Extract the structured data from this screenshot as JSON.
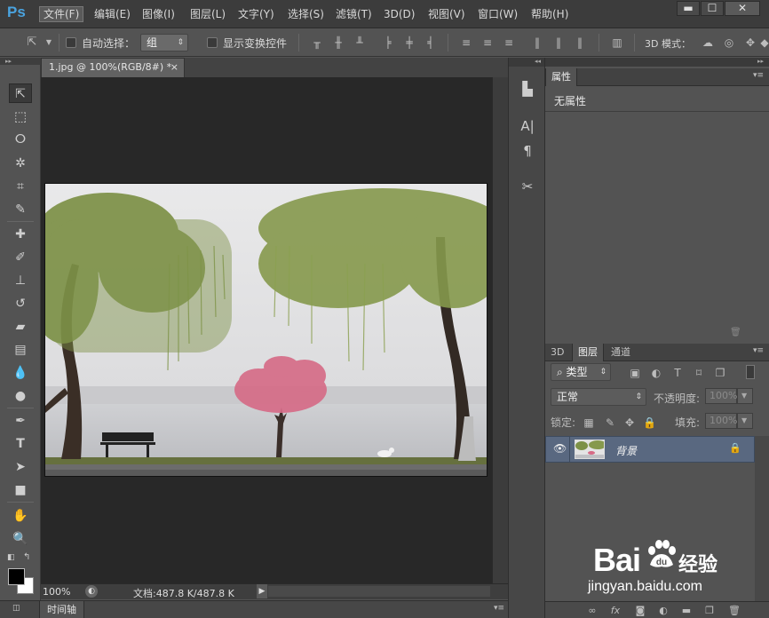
{
  "app": {
    "logo": "Ps",
    "menu": [
      "文件(F)",
      "编辑(E)",
      "图像(I)",
      "图层(L)",
      "文字(Y)",
      "选择(S)",
      "滤镜(T)",
      "3D(D)",
      "视图(V)",
      "窗口(W)",
      "帮助(H)"
    ],
    "window_controls": {
      "minimize": "▬",
      "maximize": "☐",
      "close": "✕"
    }
  },
  "options_bar": {
    "auto_select_label": "自动选择：",
    "auto_select_value": "组",
    "show_transform_label": "显示变换控件",
    "mode_3d_label": "3D 模式："
  },
  "document": {
    "tab_title": "1.jpg @ 100%(RGB/8#) *",
    "tab_close": "×",
    "zoom": "100%",
    "doc_info": "文档:487.8 K/487.8 K"
  },
  "timeline": {
    "label": "时间轴"
  },
  "properties_panel": {
    "tab": "属性",
    "content": "无属性"
  },
  "layers_panel": {
    "tabs": [
      "3D",
      "图层",
      "通道"
    ],
    "active_tab": "图层",
    "filter_label": "类型",
    "blend_mode": "正常",
    "opacity_label": "不透明度:",
    "opacity_value": "100%",
    "lock_label": "锁定:",
    "fill_label": "填充:",
    "fill_value": "100%",
    "layers": [
      {
        "name": "背景",
        "visible": true,
        "locked": true
      }
    ]
  },
  "watermark": {
    "brand_left": "Bai",
    "brand_right": "经验",
    "url": "jingyan.baidu.com"
  },
  "colors": {
    "accent": "#4aa3df",
    "selected_layer": "#596880",
    "foreground": "#000000",
    "background": "#ffffff"
  }
}
